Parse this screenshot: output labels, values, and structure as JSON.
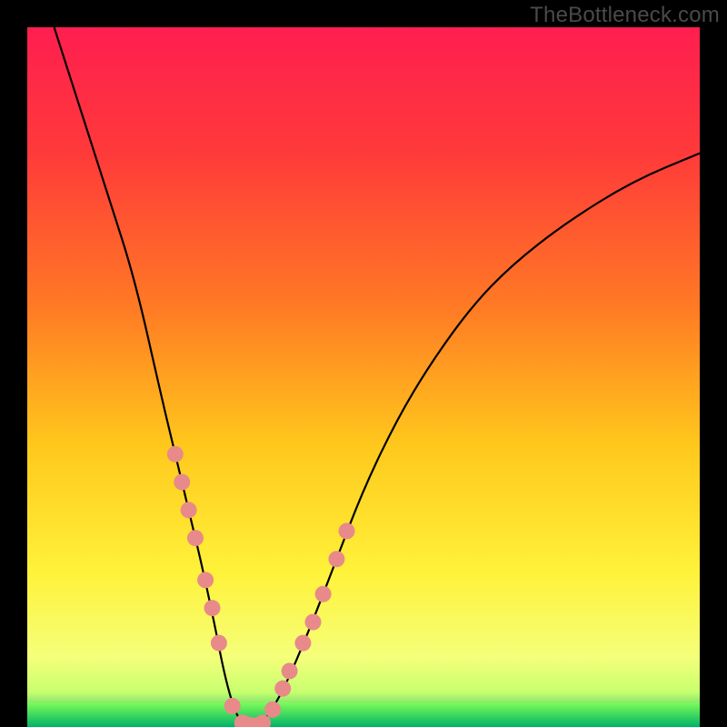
{
  "watermark": "TheBottleneck.com",
  "chart_data": {
    "type": "line",
    "title": "",
    "xlabel": "",
    "ylabel": "",
    "xlim": [
      0,
      100
    ],
    "ylim": [
      0,
      100
    ],
    "grid": false,
    "legend": false,
    "series": [
      {
        "name": "black-curve",
        "color": "#000000",
        "x": [
          4,
          8,
          12,
          16,
          20,
          22,
          24,
          26,
          28,
          29,
          30,
          31,
          32,
          33.5,
          35,
          38,
          42,
          46,
          50,
          55,
          60,
          66,
          72,
          80,
          90,
          100
        ],
        "y": [
          100,
          88,
          76,
          64,
          47,
          39,
          31,
          23,
          14,
          9,
          5,
          2,
          0.5,
          0.2,
          0.5,
          5,
          14,
          24,
          34,
          44,
          52,
          60,
          66,
          72,
          78,
          82
        ]
      }
    ],
    "pink_markers": {
      "color": "#e88a8a",
      "radius_px": 9,
      "points": [
        {
          "x": 22.0,
          "y": 39
        },
        {
          "x": 23.0,
          "y": 35
        },
        {
          "x": 24.0,
          "y": 31
        },
        {
          "x": 25.0,
          "y": 27
        },
        {
          "x": 26.5,
          "y": 21
        },
        {
          "x": 27.5,
          "y": 17
        },
        {
          "x": 28.5,
          "y": 12
        },
        {
          "x": 30.5,
          "y": 3
        },
        {
          "x": 32.0,
          "y": 0.6
        },
        {
          "x": 33.0,
          "y": 0.3
        },
        {
          "x": 34.0,
          "y": 0.2
        },
        {
          "x": 35.0,
          "y": 0.6
        },
        {
          "x": 36.5,
          "y": 2.5
        },
        {
          "x": 38.0,
          "y": 5.5
        },
        {
          "x": 39.0,
          "y": 8
        },
        {
          "x": 41.0,
          "y": 12
        },
        {
          "x": 42.5,
          "y": 15
        },
        {
          "x": 44.0,
          "y": 19
        },
        {
          "x": 46.0,
          "y": 24
        },
        {
          "x": 47.5,
          "y": 28
        }
      ]
    },
    "bottom_band": {
      "color_top": "#7efc58",
      "color_bottom": "#00b268",
      "y_from": 0,
      "y_to": 3.5
    },
    "gradient_stops": [
      {
        "pct": 0,
        "color": "#ff1e50"
      },
      {
        "pct": 18,
        "color": "#ff3a3a"
      },
      {
        "pct": 40,
        "color": "#ff7a24"
      },
      {
        "pct": 60,
        "color": "#ffc91c"
      },
      {
        "pct": 78,
        "color": "#fff23a"
      },
      {
        "pct": 90,
        "color": "#f5ff7a"
      },
      {
        "pct": 95,
        "color": "#c7ff6e"
      },
      {
        "pct": 100,
        "color": "#00b268"
      }
    ]
  }
}
